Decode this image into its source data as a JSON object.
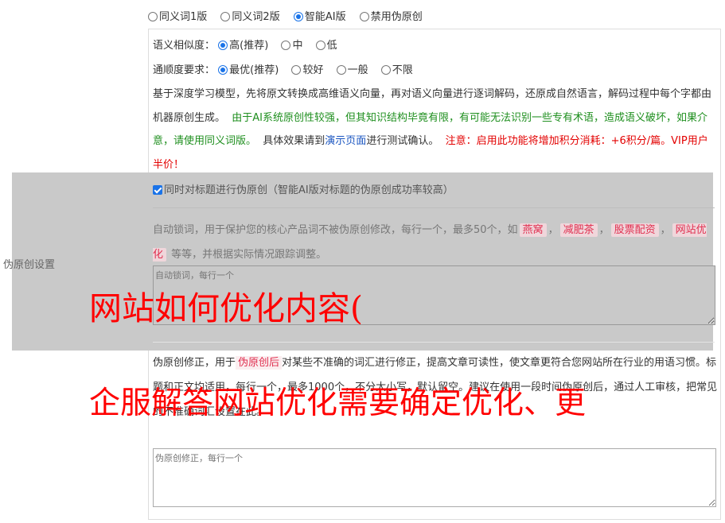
{
  "mode_options": [
    {
      "label": "同义词1版",
      "selected": false
    },
    {
      "label": "同义词2版",
      "selected": false
    },
    {
      "label": "智能AI版",
      "selected": true
    },
    {
      "label": "禁用伪原创",
      "selected": false
    }
  ],
  "similarity": {
    "label": "语义相似度：",
    "options": [
      {
        "label": "高(推荐)",
        "selected": true
      },
      {
        "label": "中",
        "selected": false
      },
      {
        "label": "低",
        "selected": false
      }
    ]
  },
  "fluency": {
    "label": "通顺度要求：",
    "options": [
      {
        "label": "最优(推荐)",
        "selected": true
      },
      {
        "label": "较好",
        "selected": false
      },
      {
        "label": "一般",
        "selected": false
      },
      {
        "label": "不限",
        "selected": false
      }
    ]
  },
  "description": {
    "intro": "基于深度学习模型，先将原文转换成高维语义向量，再对语义向量进行逐词解码，还原成自然语言，解码过程中每个字都由机器原创生成。",
    "warning_green": "由于AI系统原创性较强，但其知识结构毕竟有限，有可能无法识别一些专有术语，造成语义破坏，如果介意，请使用同义词版。",
    "effect_prefix": "具体效果请到",
    "demo_link": "演示页面",
    "effect_suffix": "进行测试确认。",
    "notice_red": "注意：启用此功能将增加积分消耗：+6积分/篇。VIP用户半价！"
  },
  "section_label": "伪原创设置",
  "title_option": {
    "label": "同时对标题进行伪原创（智能AI版对标题的伪原创成功率较高）",
    "checked": true
  },
  "lock_words": {
    "desc_before": "自动锁词，用于保护您的核心产品词不被伪原创修改，每行一个，最多50个，如",
    "tags": [
      "燕窝",
      "减肥茶",
      "股票配资",
      "网站优化"
    ],
    "sep": "，",
    "desc_after": "等等，并根据实际情况跟踪调整。",
    "placeholder": "自动锁词，每行一个"
  },
  "fix_words": {
    "desc_before": "伪原创修正，用于",
    "tag": "伪原创后",
    "desc_after": "对某些不准确的词汇进行修正，提高文章可读性，使文章更符合您网站所在行业的用语习惯。标题和正文均适用，每行一个，最多1000个，不分大小写，默认留空。建议在使用一段时间伪原创后，通过人工审核，把常见的不准确词汇设置在此。",
    "placeholder": "伪原创修正，每行一个"
  },
  "overlay": {
    "line1": "网站如何优化内容(",
    "line2": "企服解答网站优化需要确定优化、更"
  },
  "colors": {
    "accent": "#1a73e8",
    "green": "#1f8f1f",
    "red": "#e30000",
    "overlay": "#ff0000"
  }
}
